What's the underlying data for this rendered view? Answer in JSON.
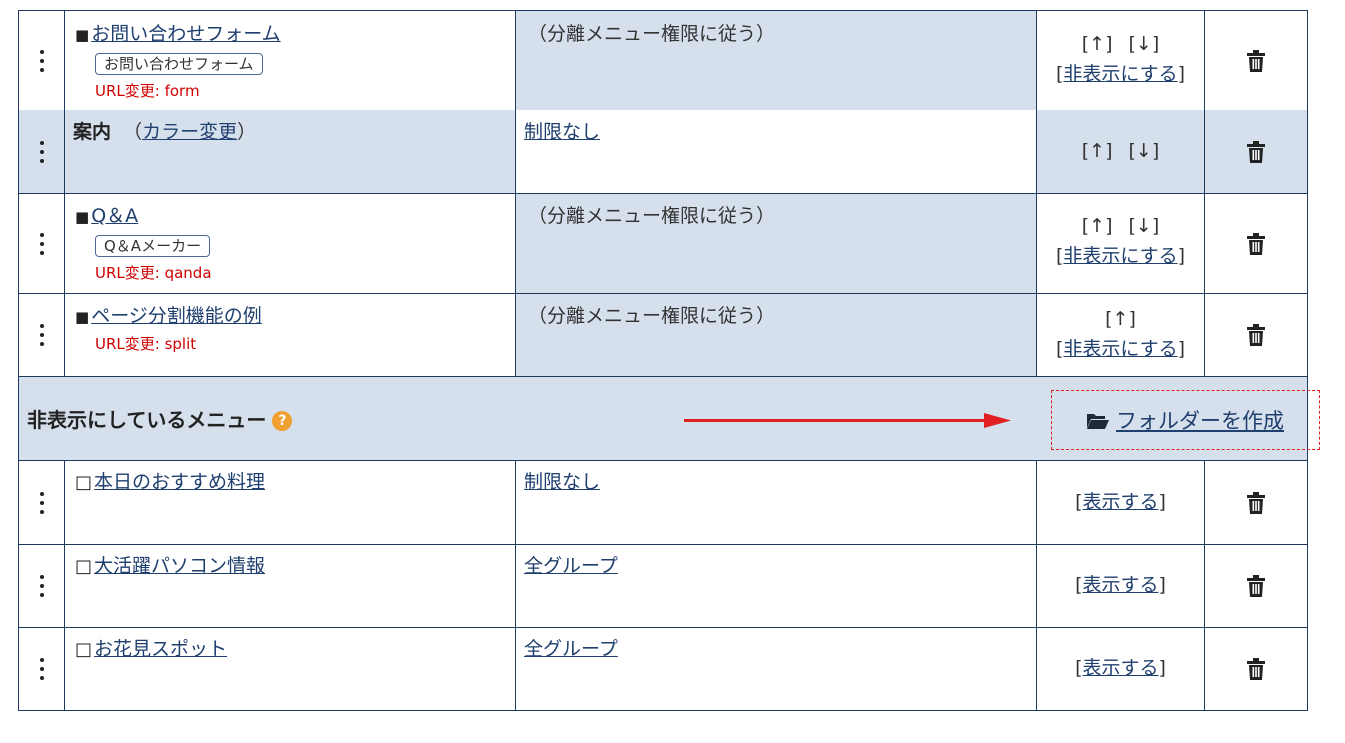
{
  "rows": [
    {
      "name": "お問い合わせフォーム",
      "bullet": "■",
      "tag": "お問い合わせフォーム",
      "url_change": "URL変更: form",
      "permission": "（分離メニュー権限に従う）",
      "up": "[↑]",
      "down": "[↓]",
      "hide": "非表示にする"
    },
    {
      "category": "案内",
      "color_change": "カラー変更",
      "permission": "制限なし",
      "up": "[↑]",
      "down": "[↓]"
    },
    {
      "name": "Q＆A",
      "bullet": "■",
      "tag": "Q＆Aメーカー",
      "url_change": "URL変更: qanda",
      "permission": "（分離メニュー権限に従う）",
      "up": "[↑]",
      "down": "[↓]",
      "hide": "非表示にする"
    },
    {
      "name": "ページ分割機能の例",
      "bullet": "■",
      "url_change": "URL変更: split",
      "permission": "（分離メニュー権限に従う）",
      "up": "[↑]",
      "hide": "非表示にする"
    }
  ],
  "hidden_section": {
    "title": "非表示にしているメニュー",
    "help": "?",
    "create_folder": "フォルダーを作成"
  },
  "hidden_rows": [
    {
      "bullet": "□",
      "name": "本日のおすすめ料理",
      "permission": "制限なし",
      "show": "表示する"
    },
    {
      "bullet": "□",
      "name": "大活躍パソコン情報",
      "permission": "全グループ",
      "show": "表示する"
    },
    {
      "bullet": "□",
      "name": "お花見スポット",
      "permission": "全グループ",
      "show": "表示する"
    }
  ],
  "colors": {
    "accent_red": "#e02020",
    "row_blue": "#d6e0ed",
    "link": "#1f3f6e",
    "border": "#1f3a5f"
  }
}
